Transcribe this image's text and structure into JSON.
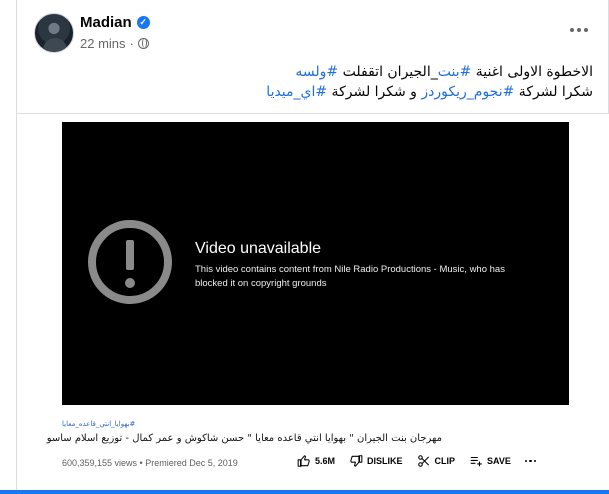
{
  "post": {
    "author": "Madian",
    "time": "22 mins",
    "separator": "·",
    "verified_glyph": "✓",
    "text_line1": {
      "lead": "الاخطوة الاولى اغنية ",
      "tag1": "#بنت",
      "mid": "_الجيران اتقفلت ",
      "tag2": "#ولسه"
    },
    "text_line2": {
      "lead": "شكرا لشركة ",
      "tag1": "#نجوم_ريكوردز",
      "mid": " و شكرا لشركة ",
      "tag2": "#اي_ميديا"
    }
  },
  "video": {
    "unavailable_title": "Video unavailable",
    "unavailable_message": "This video contains content from Nile Radio Productions - Music, who has blocked it on copyright grounds",
    "hashtag": "#بهوايا_انتي_قاعده_معايا",
    "title": "مهرجان بنت الجيران \" بهوايا انتي قاعده معايا \" حسن شاكوش و عمر كمال - توزيع اسلام ساسو",
    "views": "600,359,155 views • Premiered Dec 5, 2019",
    "likes": "5.6M",
    "dislike_label": "DISLIKE",
    "clip_label": "CLIP",
    "save_label": "SAVE"
  },
  "icons": {
    "verified": "verified-badge-icon",
    "globe": "globe-icon",
    "more": "more-dots-icon",
    "warning": "warning-icon",
    "like": "thumbs-up-icon",
    "dislike": "thumbs-down-icon",
    "clip": "scissors-icon",
    "save": "playlist-add-icon"
  },
  "colors": {
    "link": "#216fdb",
    "verified": "#1877f2",
    "video_bg": "#000000"
  }
}
